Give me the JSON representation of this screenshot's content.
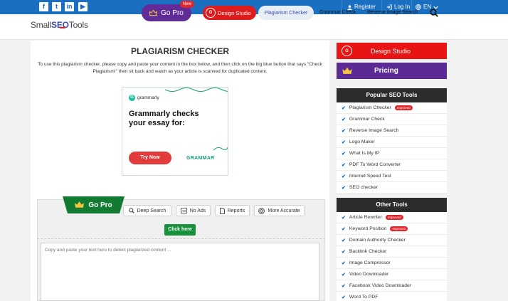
{
  "topbar": {
    "social": [
      "f",
      "t",
      "in",
      "▶"
    ],
    "register": "Register",
    "login": "Log In",
    "lang": "EN"
  },
  "header": {
    "logo_small": "Small",
    "logo_seo": "SEO",
    "logo_tools": "Tools",
    "gopro": "Go Pro",
    "new_badge": "New",
    "design_studio": "Design Studio",
    "nav_active": "Plagiarism Checker",
    "nav_grammar": "Grammar Check",
    "nav_reverse": "Reverse Image Search"
  },
  "main": {
    "title": "PLAGIARISM CHECKER",
    "intro": "To use this plagiarism checker, please copy and paste your content in the box below, and then click on the big blue button that says \"Check Plagiarism!\" then sit back and watch as your article is scanned for duplicated content.",
    "ad": {
      "brand": "grammarly",
      "headline": "Grammarly checks your essay for:",
      "cta": "Try Now",
      "word": "GRAMMAR"
    },
    "ribbon": "Go Pro",
    "options": [
      "Deep Search",
      "No Ads",
      "Reports",
      "More Accurate"
    ],
    "click_here": "Click here",
    "placeholder": "Copy and paste your text here to detect plagiarized content ..."
  },
  "sidebar": {
    "design_studio": "Design Studio",
    "pricing": "Pricing",
    "popular_title": "Popular SEO Tools",
    "popular": [
      {
        "label": "Plagiarism Checker",
        "badge": "Improved"
      },
      {
        "label": "Grammar Check",
        "badge": ""
      },
      {
        "label": "Reverse Image Search",
        "badge": ""
      },
      {
        "label": "Logo Maker",
        "badge": ""
      },
      {
        "label": "What Is My IP",
        "badge": ""
      },
      {
        "label": "PDF To Word Converter",
        "badge": ""
      },
      {
        "label": "Internet Speed Test",
        "badge": ""
      },
      {
        "label": "SEO checker",
        "badge": ""
      }
    ],
    "other_title": "Other Tools",
    "other": [
      {
        "label": "Article Rewriter",
        "badge": "Improved"
      },
      {
        "label": "Keyword Position",
        "badge": "Improved"
      },
      {
        "label": "Domain Authority Checker",
        "badge": ""
      },
      {
        "label": "Backlink Checker",
        "badge": ""
      },
      {
        "label": "Image Compressor",
        "badge": ""
      },
      {
        "label": "Video Downloader",
        "badge": ""
      },
      {
        "label": "Facebook Video Downloader",
        "badge": ""
      },
      {
        "label": "Word To PDF",
        "badge": ""
      }
    ]
  },
  "colors": {
    "topbar": "#1a6fc0",
    "gopro": "#5f2c98",
    "design": "#e01b1b",
    "green": "#127b31"
  }
}
